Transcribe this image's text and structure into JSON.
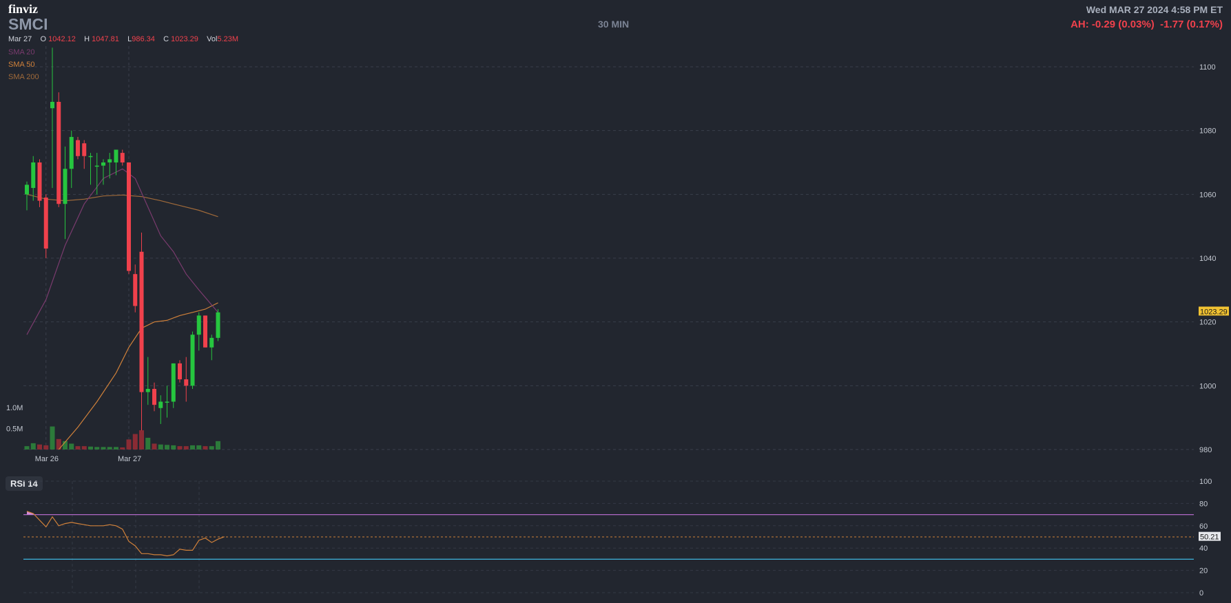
{
  "header": {
    "logo": "finviz",
    "ticker": "SMCI",
    "timeframe": "30 MIN",
    "datetime": "Wed MAR 27 2024 4:58 PM ET",
    "after_hours": "AH: -0.29 (0.03%)  -1.77 (0.17%)"
  },
  "ohlc": {
    "date": "Mar 27",
    "o_label": "O",
    "o": "1042.12",
    "h_label": "H",
    "h": "1047.81",
    "l_label": "L",
    "l": "986.34",
    "c_label": "C",
    "c": "1023.29",
    "vol_label": "Vol",
    "vol": "5.23M"
  },
  "legend": {
    "sma20": "SMA 20",
    "sma50": "SMA 50",
    "sma200": "SMA 200"
  },
  "colors": {
    "up": "#26c63f",
    "down": "#f0414c",
    "sma20": "#7a3b6e",
    "sma50": "#d0813a",
    "sma200": "#a06a3a",
    "rsi": "#d0813a",
    "rsi_upper": "#b168c8",
    "rsi_lower": "#3fb6e0",
    "last_price_bg": "#f1c232"
  },
  "rsi_panel": {
    "label": "RSI 14"
  },
  "chart_data": [
    {
      "type": "candlestick",
      "ylim": [
        980,
        1100
      ],
      "yticks": [
        980,
        1000,
        1020,
        1040,
        1060,
        1080,
        1100
      ],
      "x_labels": [
        {
          "label": "Mar 26",
          "index": 3
        },
        {
          "label": "Mar 27",
          "index": 16
        }
      ],
      "last_price": "1023.29",
      "candles": [
        {
          "o": 1060,
          "h": 1064,
          "l": 1055,
          "c": 1063
        },
        {
          "o": 1062,
          "h": 1072,
          "l": 1058,
          "c": 1070
        },
        {
          "o": 1070,
          "h": 1071,
          "l": 1056,
          "c": 1058
        },
        {
          "o": 1059,
          "h": 1060,
          "l": 1040,
          "c": 1043
        },
        {
          "o": 1087,
          "h": 1106,
          "l": 1062,
          "c": 1089
        },
        {
          "o": 1089,
          "h": 1092,
          "l": 1056,
          "c": 1057
        },
        {
          "o": 1057,
          "h": 1075,
          "l": 1046,
          "c": 1068
        },
        {
          "o": 1068,
          "h": 1080,
          "l": 1062,
          "c": 1078
        },
        {
          "o": 1077,
          "h": 1078,
          "l": 1071,
          "c": 1072
        },
        {
          "o": 1076,
          "h": 1077,
          "l": 1068,
          "c": 1072
        },
        {
          "o": 1072,
          "h": 1073,
          "l": 1063,
          "c": 1072
        },
        {
          "o": 1069,
          "h": 1073,
          "l": 1060,
          "c": 1069
        },
        {
          "o": 1069,
          "h": 1071,
          "l": 1063,
          "c": 1070
        },
        {
          "o": 1070,
          "h": 1073,
          "l": 1065,
          "c": 1071
        },
        {
          "o": 1070,
          "h": 1074,
          "l": 1066,
          "c": 1074
        },
        {
          "o": 1073,
          "h": 1074,
          "l": 1069,
          "c": 1070
        },
        {
          "o": 1070,
          "h": 1070,
          "l": 1035,
          "c": 1036
        },
        {
          "o": 1035,
          "h": 1038,
          "l": 1023,
          "c": 1025
        },
        {
          "o": 1042,
          "h": 1048,
          "l": 986,
          "c": 998
        },
        {
          "o": 998,
          "h": 1009,
          "l": 994,
          "c": 999
        },
        {
          "o": 999,
          "h": 1001,
          "l": 992,
          "c": 994
        },
        {
          "o": 993,
          "h": 997,
          "l": 988,
          "c": 995
        },
        {
          "o": 995,
          "h": 1000,
          "l": 990,
          "c": 995
        },
        {
          "o": 995,
          "h": 1007,
          "l": 993,
          "c": 1007
        },
        {
          "o": 1007,
          "h": 1008,
          "l": 1001,
          "c": 1002
        },
        {
          "o": 1002,
          "h": 1009,
          "l": 995,
          "c": 1000
        },
        {
          "o": 1000,
          "h": 1017,
          "l": 999,
          "c": 1016
        },
        {
          "o": 1016,
          "h": 1023,
          "l": 1011,
          "c": 1022
        },
        {
          "o": 1022,
          "h": 1022,
          "l": 1012,
          "c": 1012
        },
        {
          "o": 1012,
          "h": 1016,
          "l": 1008,
          "c": 1015
        },
        {
          "o": 1015,
          "h": 1024,
          "l": 1014,
          "c": 1023
        }
      ],
      "sma20": [
        {
          "i": 0,
          "v": 1016
        },
        {
          "i": 3,
          "v": 1027
        },
        {
          "i": 6,
          "v": 1044
        },
        {
          "i": 9,
          "v": 1057
        },
        {
          "i": 12,
          "v": 1065
        },
        {
          "i": 15,
          "v": 1068
        },
        {
          "i": 17,
          "v": 1065
        },
        {
          "i": 19,
          "v": 1056
        },
        {
          "i": 21,
          "v": 1047
        },
        {
          "i": 23,
          "v": 1042
        },
        {
          "i": 25,
          "v": 1035
        },
        {
          "i": 27,
          "v": 1030
        },
        {
          "i": 30,
          "v": 1023
        }
      ],
      "sma50": [
        {
          "i": 5,
          "v": 980
        },
        {
          "i": 8,
          "v": 987
        },
        {
          "i": 11,
          "v": 995
        },
        {
          "i": 14,
          "v": 1004
        },
        {
          "i": 16,
          "v": 1012
        },
        {
          "i": 18,
          "v": 1018
        },
        {
          "i": 20,
          "v": 1020
        },
        {
          "i": 22,
          "v": 1020.5
        },
        {
          "i": 24,
          "v": 1022
        },
        {
          "i": 26,
          "v": 1023
        },
        {
          "i": 28,
          "v": 1024
        },
        {
          "i": 30,
          "v": 1026
        }
      ],
      "sma200": [
        {
          "i": 0,
          "v": 1060
        },
        {
          "i": 3,
          "v": 1058.5
        },
        {
          "i": 6,
          "v": 1058
        },
        {
          "i": 9,
          "v": 1058.5
        },
        {
          "i": 12,
          "v": 1059.5
        },
        {
          "i": 15,
          "v": 1059.8
        },
        {
          "i": 18,
          "v": 1059.3
        },
        {
          "i": 21,
          "v": 1058
        },
        {
          "i": 24,
          "v": 1056.5
        },
        {
          "i": 27,
          "v": 1055
        },
        {
          "i": 30,
          "v": 1053
        }
      ],
      "volume": {
        "labels": [
          "1.0M",
          "0.5M"
        ],
        "ylim": [
          0,
          1.25
        ],
        "values": [
          0.08,
          0.15,
          0.12,
          0.1,
          0.55,
          0.25,
          0.2,
          0.14,
          0.08,
          0.08,
          0.07,
          0.06,
          0.06,
          0.06,
          0.06,
          0.05,
          0.24,
          0.37,
          0.46,
          0.28,
          0.14,
          0.12,
          0.11,
          0.1,
          0.08,
          0.08,
          0.1,
          0.1,
          0.08,
          0.08,
          0.2
        ]
      }
    },
    {
      "type": "line",
      "title": "RSI 14",
      "ylim": [
        0,
        100
      ],
      "yticks": [
        0,
        20,
        40,
        60,
        80,
        100
      ],
      "upper": 70,
      "lower": 30,
      "mid": 50,
      "last_value": "50.21",
      "values": [
        73,
        71,
        65,
        59,
        68,
        60,
        62,
        63,
        62,
        61,
        60,
        60,
        60,
        61,
        60,
        57,
        46,
        42,
        35,
        35,
        34,
        34,
        33,
        34,
        39,
        38,
        38,
        47,
        49,
        45,
        48,
        50.21
      ]
    }
  ]
}
